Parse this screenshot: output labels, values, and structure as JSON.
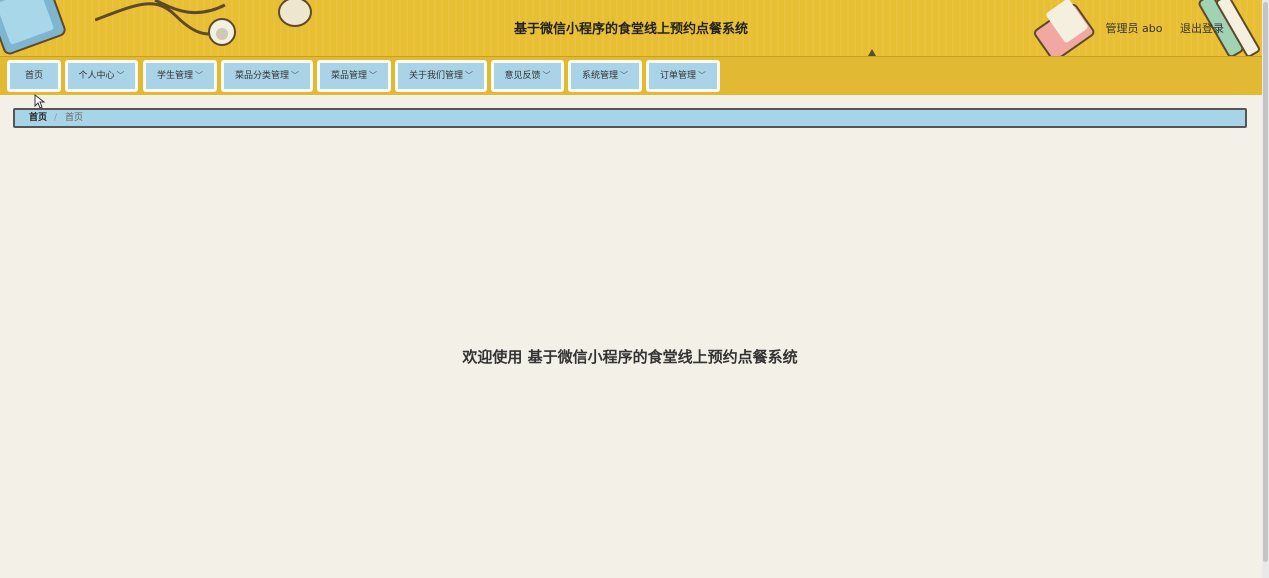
{
  "header": {
    "title": "基于微信小程序的食堂线上预约点餐系统",
    "user_label": "管理员 abo",
    "logout_label": "退出登录"
  },
  "nav": {
    "items": [
      {
        "label": "首页",
        "has_dropdown": false
      },
      {
        "label": "个人中心",
        "has_dropdown": true
      },
      {
        "label": "学生管理",
        "has_dropdown": true
      },
      {
        "label": "菜品分类管理",
        "has_dropdown": true
      },
      {
        "label": "菜品管理",
        "has_dropdown": true
      },
      {
        "label": "关于我们管理",
        "has_dropdown": true
      },
      {
        "label": "意见反馈",
        "has_dropdown": true
      },
      {
        "label": "系统管理",
        "has_dropdown": true
      },
      {
        "label": "订单管理",
        "has_dropdown": true
      }
    ],
    "chevron_icon": "chevron-down-icon"
  },
  "breadcrumb": {
    "home": "首页",
    "separator": "/",
    "current": "首页"
  },
  "main": {
    "welcome_text": "欢迎使用 基于微信小程序的食堂线上预约点餐系统"
  },
  "colors": {
    "header_bg": "#e8bf33",
    "nav_item_bg": "#a9d3e6",
    "page_bg": "#f3f1e7"
  }
}
